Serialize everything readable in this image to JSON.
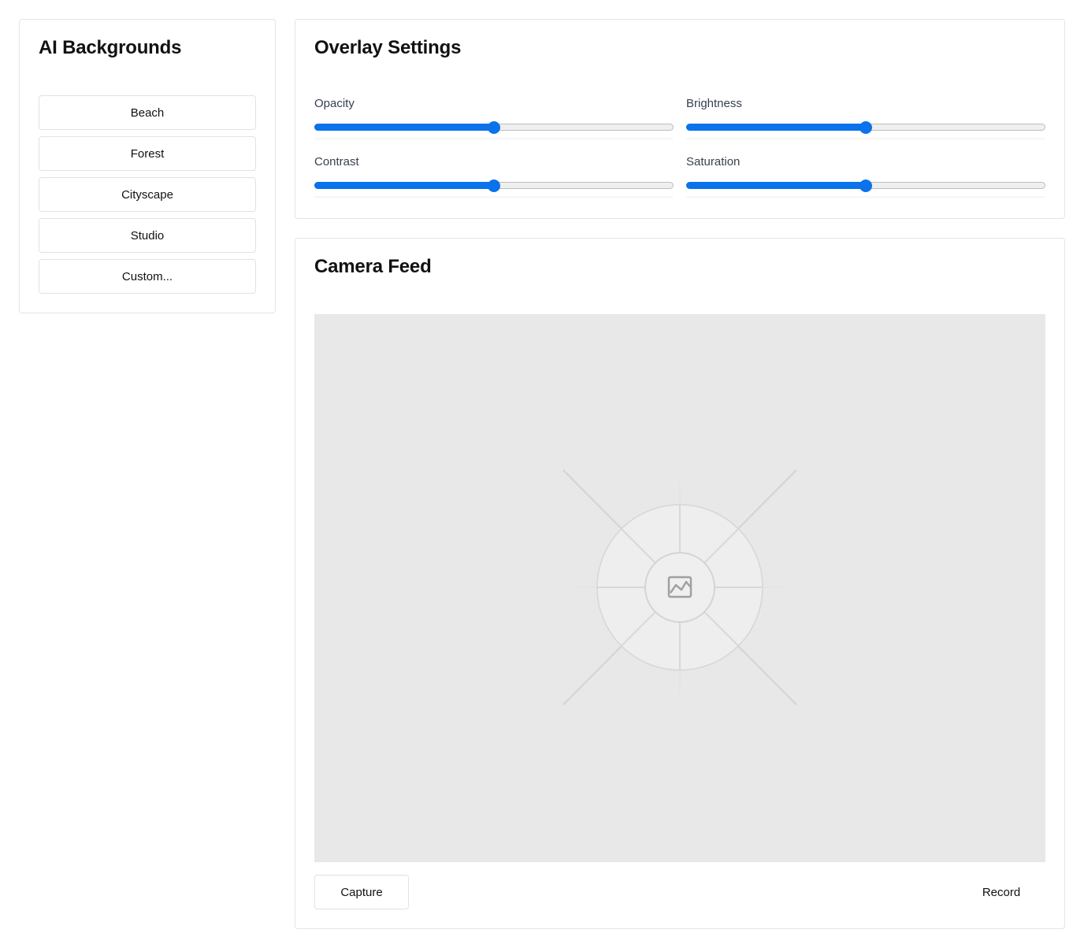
{
  "backgrounds": {
    "title": "AI Backgrounds",
    "items": [
      {
        "label": "Beach"
      },
      {
        "label": "Forest"
      },
      {
        "label": "Cityscape"
      },
      {
        "label": "Studio"
      },
      {
        "label": "Custom..."
      }
    ]
  },
  "overlay": {
    "title": "Overlay Settings",
    "sliders": [
      {
        "label": "Opacity",
        "value": 50,
        "min": 0,
        "max": 100
      },
      {
        "label": "Brightness",
        "value": 50,
        "min": 0,
        "max": 100
      },
      {
        "label": "Contrast",
        "value": 50,
        "min": 0,
        "max": 100
      },
      {
        "label": "Saturation",
        "value": 50,
        "min": 0,
        "max": 100
      }
    ]
  },
  "camera": {
    "title": "Camera Feed",
    "placeholder_icon": "image-icon",
    "capture_label": "Capture",
    "record_label": "Record"
  },
  "colors": {
    "accent": "#0a72ea",
    "feed_background": "#e8e8e8"
  }
}
